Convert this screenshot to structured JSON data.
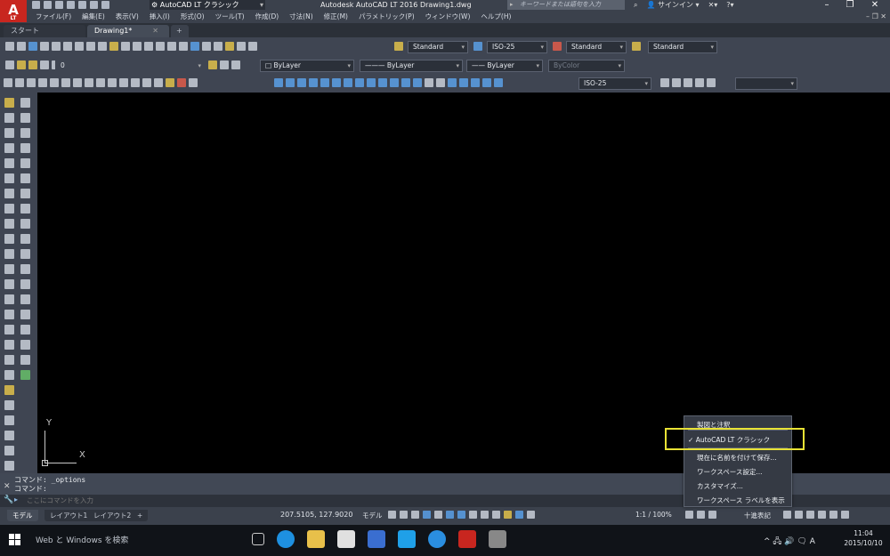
{
  "window": {
    "workspace_combo": "AutoCAD LT クラシック",
    "title": "Autodesk AutoCAD LT 2016   Drawing1.dwg",
    "search_placeholder": "キーワードまたは語句を入力",
    "signin": "サインイン"
  },
  "menu": [
    "ファイル(F)",
    "編集(E)",
    "表示(V)",
    "挿入(I)",
    "形式(O)",
    "ツール(T)",
    "作成(D)",
    "寸法(N)",
    "修正(M)",
    "パラメトリック(P)",
    "ウィンドウ(W)",
    "ヘルプ(H)"
  ],
  "tabs": {
    "start": "スタート",
    "drawing": "Drawing1*"
  },
  "toolbar_row1": {
    "text_style": "Standard",
    "dim_style": "ISO-25",
    "table_style": "Standard",
    "multileader_style": "Standard"
  },
  "toolbar_row2": {
    "layer": "0",
    "color": "ByLayer",
    "linetype": "ByLayer",
    "lineweight": "ByLayer",
    "plotstyle": "ByColor"
  },
  "toolbar_row3": {
    "dim_style": "ISO-25"
  },
  "ucs": {
    "x_label": "X",
    "y_label": "Y"
  },
  "command": {
    "history": [
      "コマンド: _options",
      "コマンド:"
    ],
    "placeholder": "ここにコマンドを入力"
  },
  "layout_tabs": [
    "モデル",
    "レイアウト1",
    "レイアウト2",
    "+"
  ],
  "status": {
    "coords": "207.5105, 127.9020",
    "model": "モデル",
    "scale": "1:1 / 100%",
    "units": "十進表記"
  },
  "workspace_menu": {
    "items": [
      "製図と注釈",
      "AutoCAD LT クラシック",
      "現在に名前を付けて保存...",
      "ワークスペース設定...",
      "カスタマイズ...",
      "ワークスペース ラベルを表示"
    ],
    "checked_mark": "✓"
  },
  "taskbar": {
    "search": "Web と Windows を検索",
    "time": "11:04",
    "date": "2015/10/10",
    "ime": "A"
  },
  "colors": {
    "highlight": "#e8e235",
    "autocad_red": "#c8261f",
    "canvas": "#000000"
  }
}
